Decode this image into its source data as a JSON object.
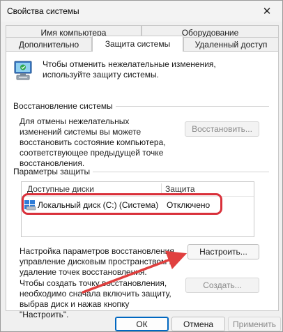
{
  "window": {
    "title": "Свойства системы",
    "close_glyph": "✕"
  },
  "tabs": {
    "top_row": [
      "Имя компьютера",
      "Оборудование"
    ],
    "bottom_row": [
      "Дополнительно",
      "Защита системы",
      "Удаленный доступ"
    ]
  },
  "intro": {
    "text": "Чтобы отменить нежелательные изменения, используйте защиту системы."
  },
  "restore": {
    "group_label": "Восстановление системы",
    "description": "Для отмены нежелательных изменений системы вы можете восстановить состояние компьютера, соответствующее предыдущей точке восстановления.",
    "button_label": "Восстановить..."
  },
  "protection": {
    "group_label": "Параметры защиты",
    "columns": [
      "Доступные диски",
      "Защита"
    ],
    "rows": [
      {
        "disk": "Локальный диск (C:) (Система)",
        "status": "Отключено"
      }
    ]
  },
  "configure": {
    "description": "Настройка параметров восстановления, управление дисковым пространством и удаление точек восстановления.",
    "button_label": "Настроить..."
  },
  "create": {
    "description": "Чтобы создать точку восстановления, необходимо сначала включить защиту, выбрав диск и нажав кнопку \"Настроить\".",
    "button_label": "Создать..."
  },
  "footer": {
    "ok": "ОК",
    "cancel": "Отмена",
    "apply": "Применить"
  },
  "colors": {
    "highlight": "#d9303a",
    "arrow": "#e0403f",
    "accent": "#0067c0"
  }
}
